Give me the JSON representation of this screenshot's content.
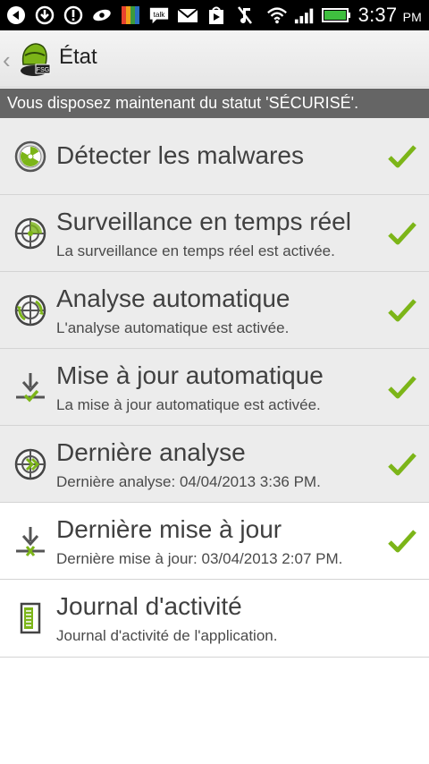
{
  "status_bar": {
    "time": "3:37",
    "ampm": "PM",
    "talk_label": "talk",
    "icons": [
      "usb-debug-icon",
      "download-icon",
      "alert-icon",
      "eye-icon",
      "avg-icon",
      "talk-icon",
      "mail-icon",
      "play-store-icon",
      "mute-icon",
      "wifi-icon",
      "signal-icon",
      "battery-icon"
    ]
  },
  "action_bar": {
    "title": "État",
    "logo_badge": "FSG"
  },
  "banner": {
    "text": "Vous disposez maintenant du statut 'SÉCURISÉ'."
  },
  "rows": [
    {
      "title": "Détecter les malwares",
      "subtitle": "",
      "icon": "radiation-icon",
      "checked": true
    },
    {
      "title": "Surveillance en temps réel",
      "subtitle": "La surveillance en temps réel est activée.",
      "icon": "radar-target-icon",
      "checked": true
    },
    {
      "title": "Analyse automatique",
      "subtitle": "L'analyse automatique est activée.",
      "icon": "radar-scan-icon",
      "checked": true
    },
    {
      "title": "Mise à jour automatique",
      "subtitle": "La mise à jour automatique est activée.",
      "icon": "download-check-icon",
      "checked": true
    },
    {
      "title": "Dernière analyse",
      "subtitle": "Dernière analyse: 04/04/2013 3:36 PM.",
      "icon": "radar-history-icon",
      "checked": true
    },
    {
      "title": "Dernière mise à jour",
      "subtitle": "Dernière mise à jour: 03/04/2013 2:07 PM.",
      "icon": "download-history-icon",
      "checked": true
    },
    {
      "title": "Journal d'activité",
      "subtitle": "Journal d'activité de l'application.",
      "icon": "log-document-icon",
      "checked": false
    }
  ],
  "colors": {
    "accent_green": "#7cb518",
    "banner_bg": "#656565",
    "row_bg": "#ececec",
    "highlight_bg": "#ffffff"
  }
}
